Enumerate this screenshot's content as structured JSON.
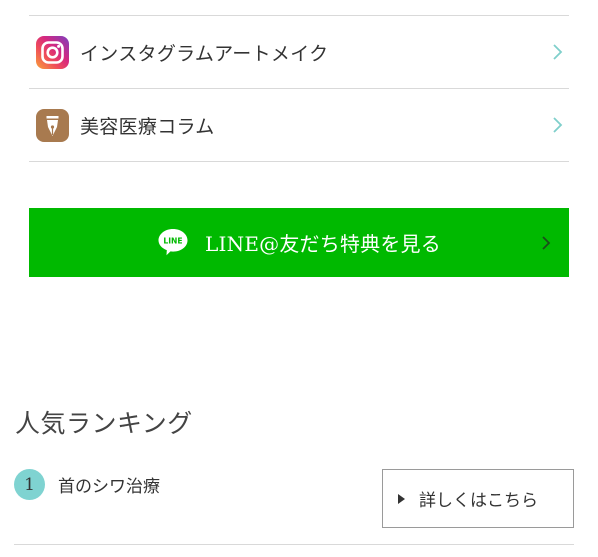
{
  "menu": {
    "items": [
      {
        "label": "インスタグラムアートメイク",
        "icon": "instagram-icon"
      },
      {
        "label": "美容医療コラム",
        "icon": "fountain-pen-icon"
      }
    ]
  },
  "line_button": {
    "logo_text": "LINE",
    "label": "LINE@友だち特典を見る",
    "icon": "line-logo-icon"
  },
  "ranking": {
    "title": "人気ランキング",
    "items": [
      {
        "rank": "1",
        "label": "首のシワ治療"
      }
    ],
    "detail_label": "詳しくはこちら"
  },
  "colors": {
    "line_green": "#00b900",
    "rank_badge": "#7fd3d1",
    "chevron_teal": "#7fcfcb",
    "column_icon_bg": "#a87a4f"
  }
}
